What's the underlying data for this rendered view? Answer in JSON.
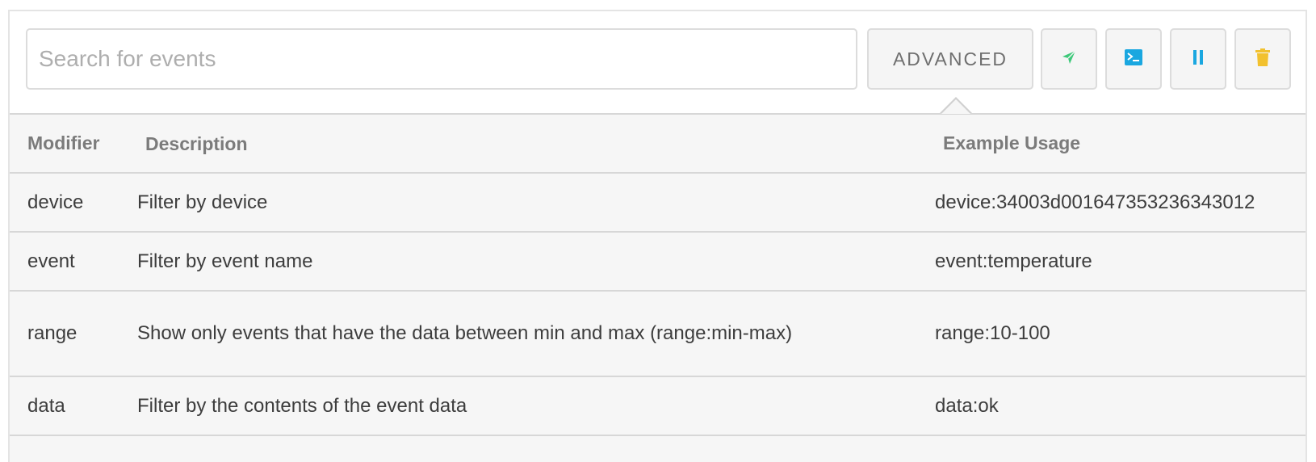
{
  "search": {
    "placeholder": "Search for events",
    "value": ""
  },
  "toolbar": {
    "advanced_label": "ADVANCED",
    "buttons": [
      {
        "icon": "send-icon",
        "color": "#3ec97a"
      },
      {
        "icon": "terminal-icon",
        "color": "#1aa7e0"
      },
      {
        "icon": "pause-icon",
        "color": "#1aa7e0"
      },
      {
        "icon": "trash-icon",
        "color": "#f2c12e"
      }
    ]
  },
  "table": {
    "headers": {
      "modifier": "Modifier",
      "description": "Description",
      "example": "Example Usage"
    },
    "rows": [
      {
        "modifier": "device",
        "description": "Filter by device",
        "example": "device:34003d001647353236343012"
      },
      {
        "modifier": "event",
        "description": "Filter by event name",
        "example": "event:temperature"
      },
      {
        "modifier": "range",
        "description": "Show only events that have the data between min and max (range:min-max)",
        "example": "range:10-100"
      },
      {
        "modifier": "data",
        "description": "Filter by the contents of the event data",
        "example": "data:ok"
      }
    ]
  }
}
